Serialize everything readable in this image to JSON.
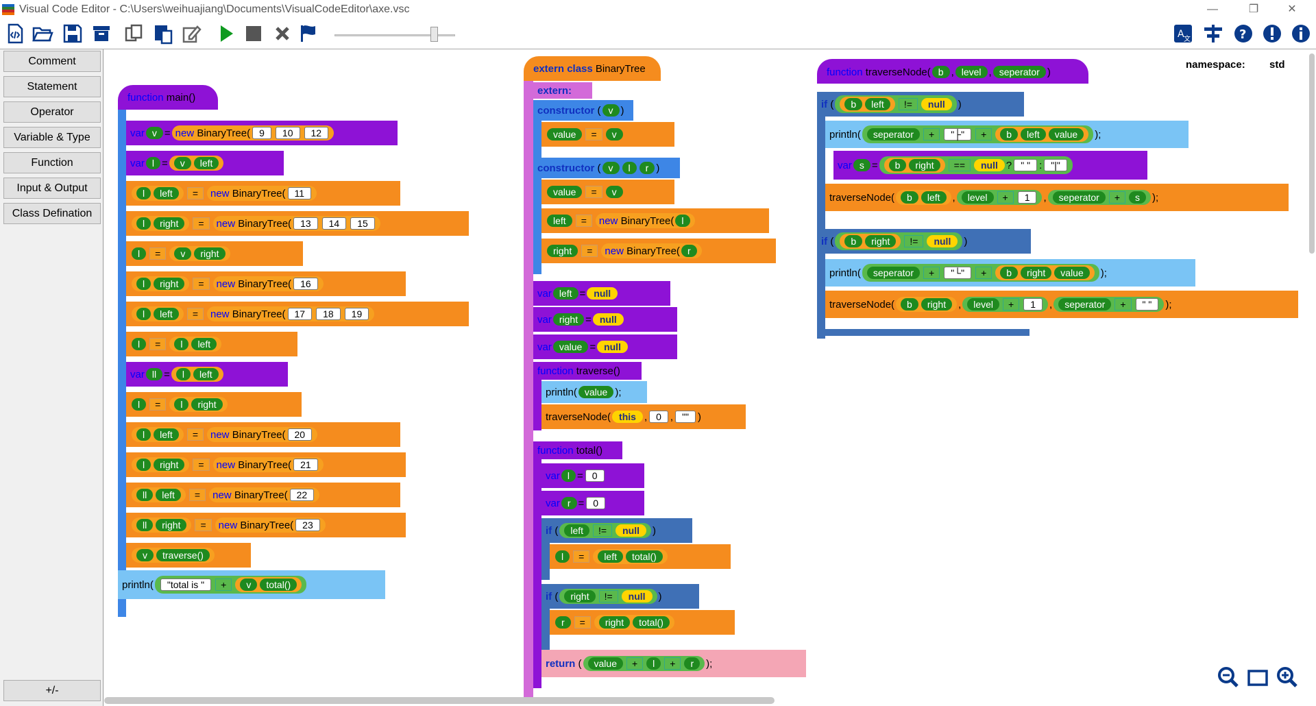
{
  "window": {
    "title": "Visual Code Editor - C:\\Users\\weihuajiang\\Documents\\VisualCodeEditor\\axe.vsc",
    "minimize": "—",
    "restore": "❐",
    "close": "✕"
  },
  "toolbar": {
    "icons": [
      "new-file-icon",
      "open-folder-icon",
      "save-icon",
      "archive-icon",
      "copy-icon",
      "paste-icon",
      "edit-icon",
      "run-icon",
      "stop-icon",
      "clear-icon",
      "flag-icon",
      "translate-icon",
      "format-icon",
      "help-icon",
      "info-alert-icon",
      "about-icon"
    ],
    "speed_percent": 85
  },
  "sidebar": {
    "categories": [
      "Comment",
      "Statement",
      "Operator",
      "Variable & Type",
      "Function",
      "Input & Output",
      "Class Defination"
    ],
    "toggle": "+/-"
  },
  "namespace": {
    "label": "namespace:",
    "value": "std"
  },
  "kw": {
    "function": "function",
    "var": "var",
    "new": "new",
    "extern_class": "extern class",
    "extern": "extern:",
    "constructor": "constructor",
    "if": "if",
    "return": "return",
    "null": "null",
    "this": "this",
    "println": "println(",
    "eq": "=",
    "neq": "!=",
    "eqeq": "==",
    "plus": "+",
    "q": "?",
    "colon": ":"
  },
  "main": {
    "header_name": "main()",
    "class": "BinaryTree(",
    "v": "v",
    "l": "l",
    "ll": "ll",
    "left": "left",
    "right": "right",
    "traverse": "traverse()",
    "total": "total()",
    "total_str": "\"total is \"",
    "nums": [
      "9",
      "10",
      "12",
      "11",
      "13",
      "14",
      "15",
      "16",
      "17",
      "18",
      "19",
      "20",
      "21",
      "22",
      "23"
    ]
  },
  "cls": {
    "header_name": "BinaryTree",
    "value": "value",
    "v": "v",
    "l": "l",
    "r": "r",
    "left": "left",
    "right": "right",
    "traverse": "traverse()",
    "total": "total()",
    "traverseNode": "traverseNode(",
    "zero": "0",
    "empty": "\"\""
  },
  "tn": {
    "header_name": "traverseNode(",
    "b": "b",
    "level": "level",
    "seperator": "seperator",
    "s": "s",
    "left": "left",
    "right": "right",
    "value": "value",
    "one": "1",
    "s1": "\"├\"",
    "s2": "\" \"",
    "s3": "\"|\"",
    "s4": "\"└\"",
    "s5": "\" \"",
    "tnode": "traverseNode("
  }
}
